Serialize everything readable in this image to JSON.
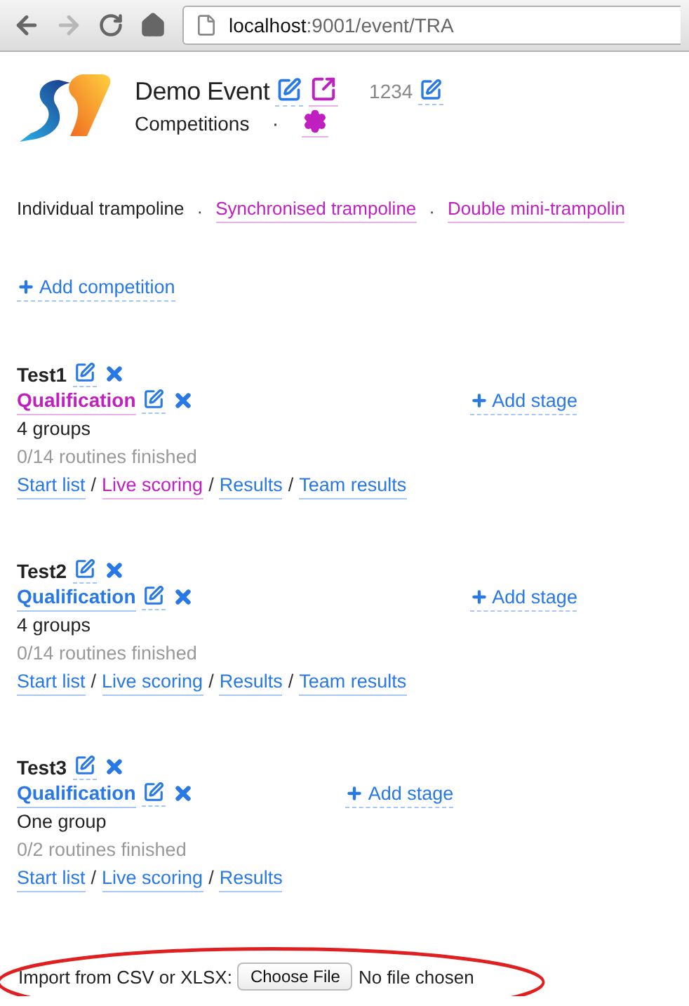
{
  "browser": {
    "back_disabled": false,
    "forward_disabled": true,
    "url_host": "localhost",
    "url_rest": ":9001/event/TRA"
  },
  "header": {
    "title": "Demo Event",
    "edit_visited": false,
    "open_visited": true,
    "code": "1234",
    "code_edit_visited": false,
    "subtitle": "Competitions",
    "separator": "·",
    "settings_visited": true
  },
  "disciplines": [
    {
      "label": "Individual trampoline",
      "selected": true
    },
    {
      "label": "Synchronised trampoline",
      "selected": false,
      "separator_before": "·"
    },
    {
      "label": "Double mini-trampolin",
      "selected": false,
      "separator_before": "·"
    }
  ],
  "add_competition": "Add competition",
  "competitions": [
    {
      "name": "Test1",
      "add_stage": "Add stage",
      "stages": [
        {
          "name": "Qualification",
          "visited": true,
          "groups": "4 groups",
          "progress": "0/14 routines finished",
          "links": [
            {
              "label": "Start list",
              "visited": false
            },
            {
              "label": "Live scoring",
              "visited": true,
              "separator_before": "/"
            },
            {
              "label": "Results",
              "visited": false,
              "separator_before": "/"
            },
            {
              "label": "Team results",
              "visited": false,
              "separator_before": "/"
            }
          ]
        }
      ]
    },
    {
      "name": "Test2",
      "add_stage": "Add stage",
      "stages": [
        {
          "name": "Qualification",
          "visited": false,
          "groups": "4 groups",
          "progress": "0/14 routines finished",
          "links": [
            {
              "label": "Start list",
              "visited": false
            },
            {
              "label": "Live scoring",
              "visited": false,
              "separator_before": "/"
            },
            {
              "label": "Results",
              "visited": false,
              "separator_before": "/"
            },
            {
              "label": "Team results",
              "visited": false,
              "separator_before": "/"
            }
          ]
        }
      ]
    },
    {
      "name": "Test3",
      "add_stage": "Add stage",
      "stages": [
        {
          "name": "Qualification",
          "visited": false,
          "groups": "One group",
          "progress": "0/2 routines finished",
          "links": [
            {
              "label": "Start list",
              "visited": false
            },
            {
              "label": "Live scoring",
              "visited": false,
              "separator_before": "/"
            },
            {
              "label": "Results",
              "visited": false,
              "separator_before": "/"
            }
          ]
        }
      ]
    }
  ],
  "import": {
    "label": "Import from CSV or XLSX:",
    "button": "Choose File",
    "status": "No file chosen",
    "highlighted": true
  }
}
